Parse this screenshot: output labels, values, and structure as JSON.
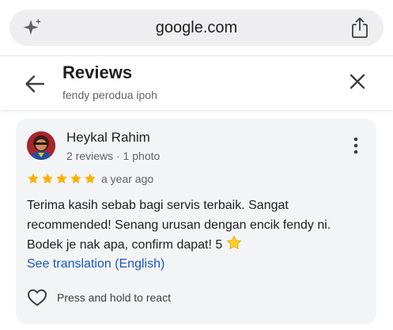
{
  "browser": {
    "url": "google.com",
    "icons": {
      "left": "sparkle-icon",
      "right": "share-icon"
    }
  },
  "header": {
    "title": "Reviews",
    "subtitle": "fendy perodua ipoh",
    "icons": {
      "back": "arrow-left-icon",
      "close": "close-icon"
    }
  },
  "review": {
    "author": "Heykal Rahim",
    "author_meta": "2 reviews · 1 photo",
    "rating": 5,
    "rating_max": 5,
    "time": "a year ago",
    "text": "Terima kasih sebab bagi servis terbaik. Sangat recommended! Senang urusan dengan encik fendy ni. Bodek je nak apa, confirm dapat! 5",
    "text_emoji": "star-emoji",
    "translation_link": "See translation (English)",
    "react_label": "Press and hold to react",
    "icons": {
      "more": "more-vertical-icon",
      "react": "heart-outline-icon",
      "avatar": "avatar"
    }
  },
  "colors": {
    "star": "#f9b200",
    "link": "#1a56c4",
    "card_bg": "#f3f4f6",
    "url_bar_bg": "#eeeef0"
  }
}
